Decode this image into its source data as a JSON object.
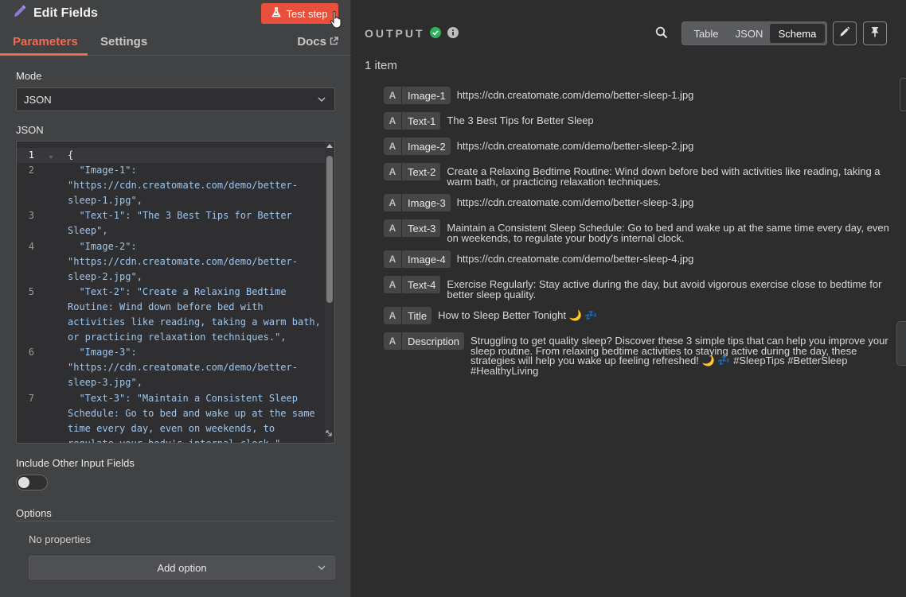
{
  "header": {
    "title": "Edit Fields",
    "test_step": "Test step",
    "tabs": [
      "Parameters",
      "Settings"
    ],
    "docs": "Docs"
  },
  "params": {
    "mode_label": "Mode",
    "mode_value": "JSON",
    "json_label": "JSON",
    "include_label": "Include Other Input Fields",
    "include_on": false,
    "options_label": "Options",
    "no_props": "No properties",
    "add_option": "Add option"
  },
  "editor": {
    "lines": [
      {
        "n": "1",
        "fold": "⌄",
        "text": "{",
        "brace": true
      },
      {
        "n": "2",
        "text": "  \"Image-1\":"
      },
      {
        "n": "",
        "text": "\"https://cdn.creatomate.com/demo/better-"
      },
      {
        "n": "",
        "text": "sleep-1.jpg\","
      },
      {
        "n": "3",
        "text": "  \"Text-1\": \"The 3 Best Tips for Better"
      },
      {
        "n": "",
        "text": "Sleep\","
      },
      {
        "n": "4",
        "text": "  \"Image-2\":"
      },
      {
        "n": "",
        "text": "\"https://cdn.creatomate.com/demo/better-"
      },
      {
        "n": "",
        "text": "sleep-2.jpg\","
      },
      {
        "n": "5",
        "text": "  \"Text-2\": \"Create a Relaxing Bedtime"
      },
      {
        "n": "",
        "text": "Routine: Wind down before bed with"
      },
      {
        "n": "",
        "text": "activities like reading, taking a warm bath,"
      },
      {
        "n": "",
        "text": "or practicing relaxation techniques.\","
      },
      {
        "n": "6",
        "text": "  \"Image-3\":"
      },
      {
        "n": "",
        "text": "\"https://cdn.creatomate.com/demo/better-"
      },
      {
        "n": "",
        "text": "sleep-3.jpg\","
      },
      {
        "n": "7",
        "text": "  \"Text-3\": \"Maintain a Consistent Sleep"
      },
      {
        "n": "",
        "text": "Schedule: Go to bed and wake up at the same"
      },
      {
        "n": "",
        "text": "time every day, even on weekends, to"
      },
      {
        "n": "",
        "text": "regulate your body's internal clock.\","
      }
    ]
  },
  "output": {
    "title": "OUTPUT",
    "views": [
      "Table",
      "JSON",
      "Schema"
    ],
    "active_view": "Schema",
    "count": "1 item",
    "fields": [
      {
        "type": "A",
        "name": "Image-1",
        "value": "https://cdn.creatomate.com/demo/better-sleep-1.jpg"
      },
      {
        "type": "A",
        "name": "Text-1",
        "value": "The 3 Best Tips for Better Sleep"
      },
      {
        "type": "A",
        "name": "Image-2",
        "value": "https://cdn.creatomate.com/demo/better-sleep-2.jpg"
      },
      {
        "type": "A",
        "name": "Text-2",
        "value": "Create a Relaxing Bedtime Routine: Wind down before bed with activities like reading, taking a warm bath, or practicing relaxation techniques."
      },
      {
        "type": "A",
        "name": "Image-3",
        "value": "https://cdn.creatomate.com/demo/better-sleep-3.jpg"
      },
      {
        "type": "A",
        "name": "Text-3",
        "value": "Maintain a Consistent Sleep Schedule: Go to bed and wake up at the same time every day, even on weekends, to regulate your body's internal clock."
      },
      {
        "type": "A",
        "name": "Image-4",
        "value": "https://cdn.creatomate.com/demo/better-sleep-4.jpg"
      },
      {
        "type": "A",
        "name": "Text-4",
        "value": "Exercise Regularly: Stay active during the day, but avoid vigorous exercise close to bedtime for better sleep quality."
      },
      {
        "type": "A",
        "name": "Title",
        "value": "How to Sleep Better Tonight 🌙 💤"
      },
      {
        "type": "A",
        "name": "Description",
        "value": "Struggling to get quality sleep? Discover these 3 simple tips that can help you improve your sleep routine. From relaxing bedtime activities to staying active during the day, these strategies will help you wake up feeling refreshed! 🌙 💤 #SleepTips #BetterSleep #HealthyLiving"
      }
    ]
  },
  "colors": {
    "accent": "#ef6c52",
    "test_button": "#e8503c",
    "success": "#2fb15e"
  }
}
